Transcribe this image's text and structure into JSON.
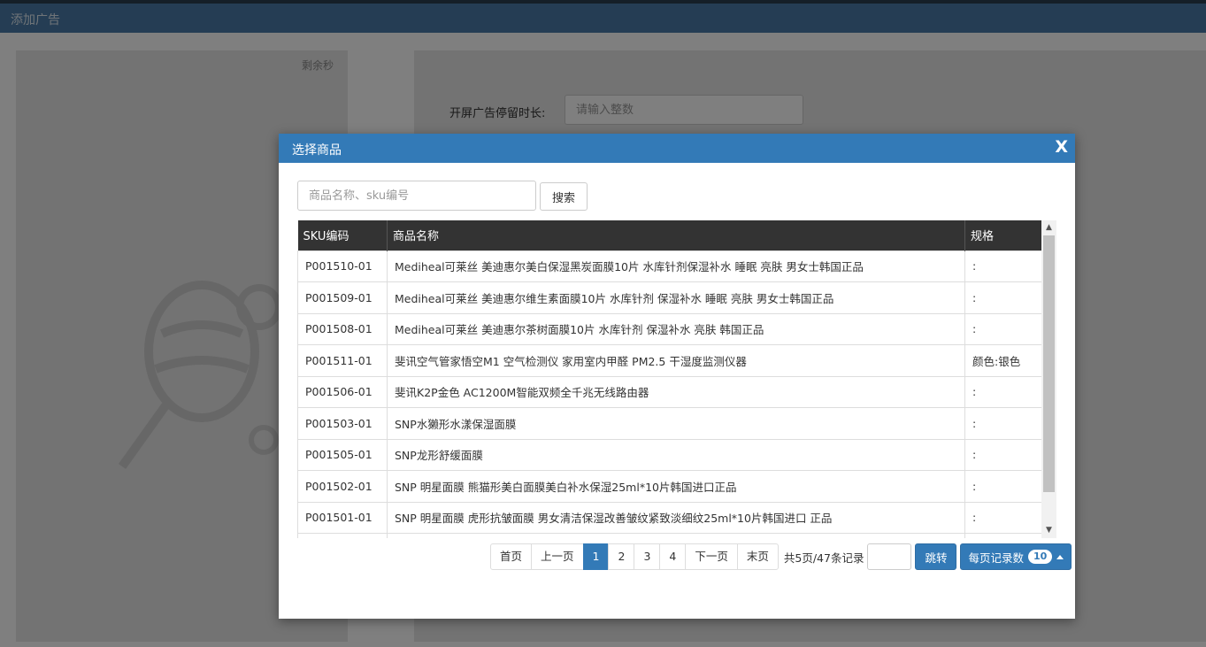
{
  "app": {
    "title": "添加广告"
  },
  "background": {
    "remain_label": "剩余秒",
    "duration_label": "开屏广告停留时长:",
    "duration_placeholder": "请输入整数"
  },
  "modal": {
    "title": "选择商品",
    "close_label": "X",
    "search_placeholder": "商品名称、sku编号",
    "search_button": "搜索",
    "columns": [
      "SKU编码",
      "商品名称",
      "规格"
    ],
    "rows": [
      {
        "sku": "P001510-01",
        "name": "Mediheal可莱丝 美迪惠尔美白保湿黑炭面膜10片 水库针剂保湿补水 睡眠 亮肤 男女士韩国正品",
        "spec": ":"
      },
      {
        "sku": "P001509-01",
        "name": "Mediheal可莱丝 美迪惠尔维生素面膜10片 水库针剂 保湿补水 睡眠 亮肤 男女士韩国正品",
        "spec": ":"
      },
      {
        "sku": "P001508-01",
        "name": "Mediheal可莱丝 美迪惠尔茶树面膜10片 水库针剂 保湿补水 亮肤 韩国正品",
        "spec": ":"
      },
      {
        "sku": "P001511-01",
        "name": "斐讯空气管家悟空M1 空气检测仪 家用室内甲醛 PM2.5 干湿度监测仪器",
        "spec": "颜色:银色"
      },
      {
        "sku": "P001506-01",
        "name": "斐讯K2P金色 AC1200M智能双频全千兆无线路由器",
        "spec": ":"
      },
      {
        "sku": "P001503-01",
        "name": "SNP水獭形水漾保湿面膜",
        "spec": ":"
      },
      {
        "sku": "P001505-01",
        "name": "SNP龙形舒缓面膜",
        "spec": ":"
      },
      {
        "sku": "P001502-01",
        "name": "SNP 明星面膜 熊猫形美白面膜美白补水保湿25ml*10片韩国进口正品",
        "spec": ":"
      },
      {
        "sku": "P001501-01",
        "name": "SNP 明星面膜 虎形抗皱面膜 男女清洁保湿改善皱纹紧致淡细纹25ml*10片韩国进口 正品",
        "spec": ":"
      }
    ],
    "pager": {
      "first": "首页",
      "prev": "上一页",
      "pages": [
        "1",
        "2",
        "3",
        "4"
      ],
      "active_page": "1",
      "next": "下一页",
      "last": "末页",
      "info": "共5页/47条记录",
      "jump_button": "跳转",
      "page_size_label": "每页记录数",
      "page_size_value": "10"
    }
  },
  "colors": {
    "header_bar": "#4a7aa8",
    "modal_header": "#337ab7",
    "table_header": "#333333",
    "primary": "#337ab7"
  }
}
